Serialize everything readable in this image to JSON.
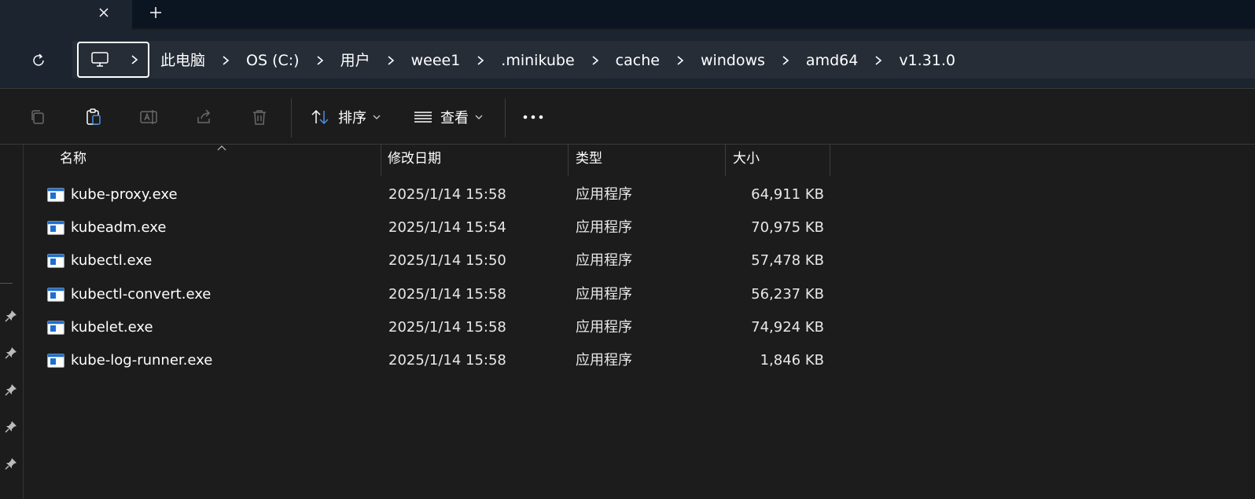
{
  "tabbar": {
    "close_icon": "close-icon",
    "new_tab_icon": "plus-icon"
  },
  "nav": {
    "refresh_icon": "refresh-icon",
    "location_icon": "computer-icon",
    "breadcrumbs": [
      "此电脑",
      "OS (C:)",
      "用户",
      "weee1",
      ".minikube",
      "cache",
      "windows",
      "amd64",
      "v1.31.0"
    ]
  },
  "toolbar": {
    "copy_icon": "copy-icon",
    "paste_icon": "paste-icon",
    "rename_icon": "rename-icon",
    "share_icon": "share-icon",
    "delete_icon": "delete-icon",
    "sort_label": "排序",
    "view_label": "查看",
    "more_icon": "more-icon"
  },
  "columns": {
    "name": "名称",
    "date": "修改日期",
    "type": "类型",
    "size": "大小"
  },
  "files": [
    {
      "name": "kube-proxy.exe",
      "date": "2025/1/14 15:58",
      "type": "应用程序",
      "size": "64,911 KB"
    },
    {
      "name": "kubeadm.exe",
      "date": "2025/1/14 15:54",
      "type": "应用程序",
      "size": "70,975 KB"
    },
    {
      "name": "kubectl.exe",
      "date": "2025/1/14 15:50",
      "type": "应用程序",
      "size": "57,478 KB"
    },
    {
      "name": "kubectl-convert.exe",
      "date": "2025/1/14 15:58",
      "type": "应用程序",
      "size": "56,237 KB"
    },
    {
      "name": "kubelet.exe",
      "date": "2025/1/14 15:58",
      "type": "应用程序",
      "size": "74,924 KB"
    },
    {
      "name": "kube-log-runner.exe",
      "date": "2025/1/14 15:58",
      "type": "应用程序",
      "size": "1,846 KB"
    }
  ],
  "colors": {
    "accent": "#4a90e2",
    "background": "#1c1c1c",
    "nav_background": "#1c2430",
    "tab_background": "#0b1522"
  }
}
